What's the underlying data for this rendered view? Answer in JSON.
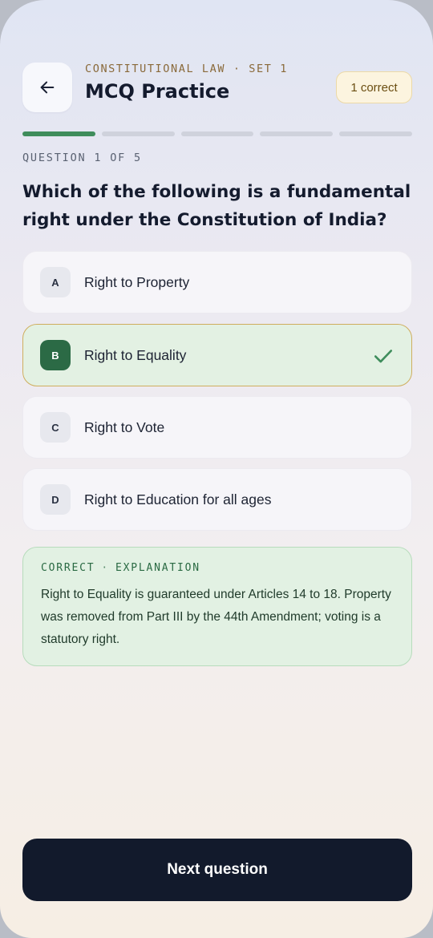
{
  "header": {
    "eyebrow": "CONSTITUTIONAL LAW · SET 1",
    "title": "MCQ Practice",
    "score_badge": "1 correct"
  },
  "progress": {
    "total_segments": 5,
    "completed_segments": 1
  },
  "question": {
    "counter": "QUESTION 1 OF 5",
    "text": "Which of the following is a fundamental right under the Constitution of India?"
  },
  "options": [
    {
      "letter": "A",
      "text": "Right to Property",
      "state": "default"
    },
    {
      "letter": "B",
      "text": "Right to Equality",
      "state": "correct"
    },
    {
      "letter": "C",
      "text": "Right to Vote",
      "state": "default"
    },
    {
      "letter": "D",
      "text": "Right to Education for all ages",
      "state": "default"
    }
  ],
  "explanation": {
    "status": "CORRECT",
    "label": "EXPLANATION",
    "separator": "·",
    "text": "Right to Equality is guaranteed under Articles 14 to 18. Property was removed from Part III by the 44th Amendment; voting is a statutory right."
  },
  "footer": {
    "next_label": "Next question"
  },
  "icons": {
    "back": "arrow-left-icon",
    "check": "checkmark-icon"
  },
  "colors": {
    "accent_green": "#2b6a45",
    "progress_done": "#3f8d5c",
    "badge_bg": "#fcf4df",
    "primary_button": "#121a2c"
  }
}
